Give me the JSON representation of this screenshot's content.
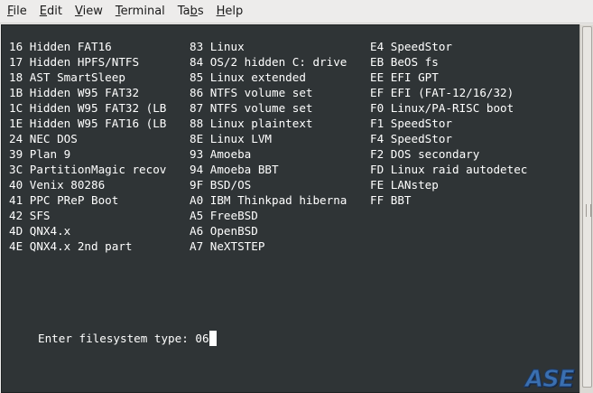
{
  "menubar": {
    "items": [
      {
        "mnemonic": "F",
        "rest": "ile"
      },
      {
        "mnemonic": "E",
        "rest": "dit"
      },
      {
        "mnemonic": "V",
        "rest": "iew"
      },
      {
        "mnemonic": "T",
        "rest": "erminal"
      },
      {
        "pre": "Ta",
        "mnemonic": "b",
        "rest": "s"
      },
      {
        "mnemonic": "H",
        "rest": "elp"
      }
    ]
  },
  "terminal": {
    "rows": [
      [
        "16 Hidden FAT16",
        "83 Linux",
        "E4 SpeedStor"
      ],
      [
        "17 Hidden HPFS/NTFS",
        "84 OS/2 hidden C: drive",
        "EB BeOS fs"
      ],
      [
        "18 AST SmartSleep",
        "85 Linux extended",
        "EE EFI GPT"
      ],
      [
        "1B Hidden W95 FAT32",
        "86 NTFS volume set",
        "EF EFI (FAT-12/16/32)"
      ],
      [
        "1C Hidden W95 FAT32 (LB",
        "87 NTFS volume set",
        "F0 Linux/PA-RISC boot"
      ],
      [
        "1E Hidden W95 FAT16 (LB",
        "88 Linux plaintext",
        "F1 SpeedStor"
      ],
      [
        "24 NEC DOS",
        "8E Linux LVM",
        "F4 SpeedStor"
      ],
      [
        "39 Plan 9",
        "93 Amoeba",
        "F2 DOS secondary"
      ],
      [
        "3C PartitionMagic recov",
        "94 Amoeba BBT",
        "FD Linux raid autodetec"
      ],
      [
        "40 Venix 80286",
        "9F BSD/OS",
        "FE LANstep"
      ],
      [
        "41 PPC PReP Boot",
        "A0 IBM Thinkpad hiberna",
        "FF BBT"
      ],
      [
        "42 SFS",
        "A5 FreeBSD",
        ""
      ],
      [
        "4D QNX4.x",
        "A6 OpenBSD",
        ""
      ],
      [
        "4E QNX4.x 2nd part",
        "A7 NeXTSTEP",
        ""
      ]
    ],
    "prompt": "Enter filesystem type: 06"
  },
  "logo": {
    "text": "ASE",
    "color": "#3a6fb0"
  },
  "colors": {
    "terminal_bg": "#2f3436",
    "terminal_fg": "#ffffff",
    "chrome_bg": "#edeceb"
  }
}
